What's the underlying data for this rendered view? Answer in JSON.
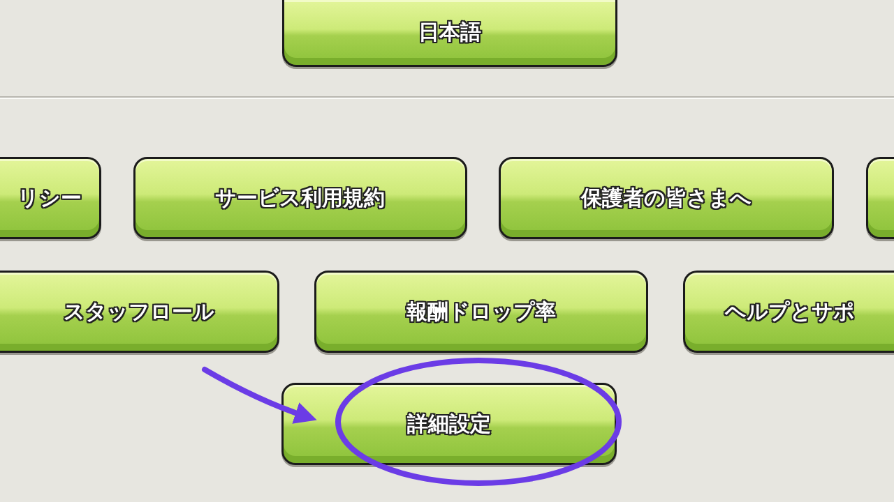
{
  "language_button": {
    "label": "日本語",
    "kind": "top_cut"
  },
  "rows": [
    {
      "buttons": [
        {
          "label": "リシー",
          "kind": "left_cut"
        },
        {
          "label": "サービス利用規約",
          "kind": "whole"
        },
        {
          "label": "保護者の皆さまへ",
          "kind": "whole"
        },
        {
          "kind": "right_cut"
        }
      ]
    },
    {
      "buttons": [
        {
          "label": "スタッフロール",
          "kind": "left_cut"
        },
        {
          "label": "報酬ドロップ率",
          "kind": "whole"
        },
        {
          "label": "ヘルプとサポ",
          "kind": "right_cut"
        }
      ]
    },
    {
      "buttons": [
        {
          "label": "詳細設定",
          "kind": "whole"
        }
      ]
    }
  ]
}
